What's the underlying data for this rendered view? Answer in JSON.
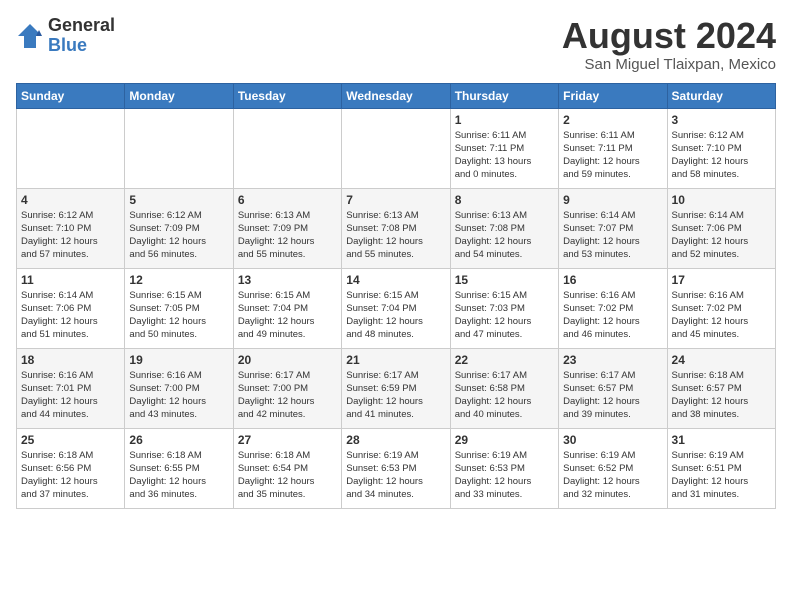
{
  "logo": {
    "general": "General",
    "blue": "Blue"
  },
  "title": {
    "month_year": "August 2024",
    "location": "San Miguel Tlaixpan, Mexico"
  },
  "days": [
    "Sunday",
    "Monday",
    "Tuesday",
    "Wednesday",
    "Thursday",
    "Friday",
    "Saturday"
  ],
  "weeks": [
    [
      {
        "date": "",
        "info": ""
      },
      {
        "date": "",
        "info": ""
      },
      {
        "date": "",
        "info": ""
      },
      {
        "date": "",
        "info": ""
      },
      {
        "date": "1",
        "info": "Sunrise: 6:11 AM\nSunset: 7:11 PM\nDaylight: 13 hours\nand 0 minutes."
      },
      {
        "date": "2",
        "info": "Sunrise: 6:11 AM\nSunset: 7:11 PM\nDaylight: 12 hours\nand 59 minutes."
      },
      {
        "date": "3",
        "info": "Sunrise: 6:12 AM\nSunset: 7:10 PM\nDaylight: 12 hours\nand 58 minutes."
      }
    ],
    [
      {
        "date": "4",
        "info": "Sunrise: 6:12 AM\nSunset: 7:10 PM\nDaylight: 12 hours\nand 57 minutes."
      },
      {
        "date": "5",
        "info": "Sunrise: 6:12 AM\nSunset: 7:09 PM\nDaylight: 12 hours\nand 56 minutes."
      },
      {
        "date": "6",
        "info": "Sunrise: 6:13 AM\nSunset: 7:09 PM\nDaylight: 12 hours\nand 55 minutes."
      },
      {
        "date": "7",
        "info": "Sunrise: 6:13 AM\nSunset: 7:08 PM\nDaylight: 12 hours\nand 55 minutes."
      },
      {
        "date": "8",
        "info": "Sunrise: 6:13 AM\nSunset: 7:08 PM\nDaylight: 12 hours\nand 54 minutes."
      },
      {
        "date": "9",
        "info": "Sunrise: 6:14 AM\nSunset: 7:07 PM\nDaylight: 12 hours\nand 53 minutes."
      },
      {
        "date": "10",
        "info": "Sunrise: 6:14 AM\nSunset: 7:06 PM\nDaylight: 12 hours\nand 52 minutes."
      }
    ],
    [
      {
        "date": "11",
        "info": "Sunrise: 6:14 AM\nSunset: 7:06 PM\nDaylight: 12 hours\nand 51 minutes."
      },
      {
        "date": "12",
        "info": "Sunrise: 6:15 AM\nSunset: 7:05 PM\nDaylight: 12 hours\nand 50 minutes."
      },
      {
        "date": "13",
        "info": "Sunrise: 6:15 AM\nSunset: 7:04 PM\nDaylight: 12 hours\nand 49 minutes."
      },
      {
        "date": "14",
        "info": "Sunrise: 6:15 AM\nSunset: 7:04 PM\nDaylight: 12 hours\nand 48 minutes."
      },
      {
        "date": "15",
        "info": "Sunrise: 6:15 AM\nSunset: 7:03 PM\nDaylight: 12 hours\nand 47 minutes."
      },
      {
        "date": "16",
        "info": "Sunrise: 6:16 AM\nSunset: 7:02 PM\nDaylight: 12 hours\nand 46 minutes."
      },
      {
        "date": "17",
        "info": "Sunrise: 6:16 AM\nSunset: 7:02 PM\nDaylight: 12 hours\nand 45 minutes."
      }
    ],
    [
      {
        "date": "18",
        "info": "Sunrise: 6:16 AM\nSunset: 7:01 PM\nDaylight: 12 hours\nand 44 minutes."
      },
      {
        "date": "19",
        "info": "Sunrise: 6:16 AM\nSunset: 7:00 PM\nDaylight: 12 hours\nand 43 minutes."
      },
      {
        "date": "20",
        "info": "Sunrise: 6:17 AM\nSunset: 7:00 PM\nDaylight: 12 hours\nand 42 minutes."
      },
      {
        "date": "21",
        "info": "Sunrise: 6:17 AM\nSunset: 6:59 PM\nDaylight: 12 hours\nand 41 minutes."
      },
      {
        "date": "22",
        "info": "Sunrise: 6:17 AM\nSunset: 6:58 PM\nDaylight: 12 hours\nand 40 minutes."
      },
      {
        "date": "23",
        "info": "Sunrise: 6:17 AM\nSunset: 6:57 PM\nDaylight: 12 hours\nand 39 minutes."
      },
      {
        "date": "24",
        "info": "Sunrise: 6:18 AM\nSunset: 6:57 PM\nDaylight: 12 hours\nand 38 minutes."
      }
    ],
    [
      {
        "date": "25",
        "info": "Sunrise: 6:18 AM\nSunset: 6:56 PM\nDaylight: 12 hours\nand 37 minutes."
      },
      {
        "date": "26",
        "info": "Sunrise: 6:18 AM\nSunset: 6:55 PM\nDaylight: 12 hours\nand 36 minutes."
      },
      {
        "date": "27",
        "info": "Sunrise: 6:18 AM\nSunset: 6:54 PM\nDaylight: 12 hours\nand 35 minutes."
      },
      {
        "date": "28",
        "info": "Sunrise: 6:19 AM\nSunset: 6:53 PM\nDaylight: 12 hours\nand 34 minutes."
      },
      {
        "date": "29",
        "info": "Sunrise: 6:19 AM\nSunset: 6:53 PM\nDaylight: 12 hours\nand 33 minutes."
      },
      {
        "date": "30",
        "info": "Sunrise: 6:19 AM\nSunset: 6:52 PM\nDaylight: 12 hours\nand 32 minutes."
      },
      {
        "date": "31",
        "info": "Sunrise: 6:19 AM\nSunset: 6:51 PM\nDaylight: 12 hours\nand 31 minutes."
      }
    ]
  ]
}
